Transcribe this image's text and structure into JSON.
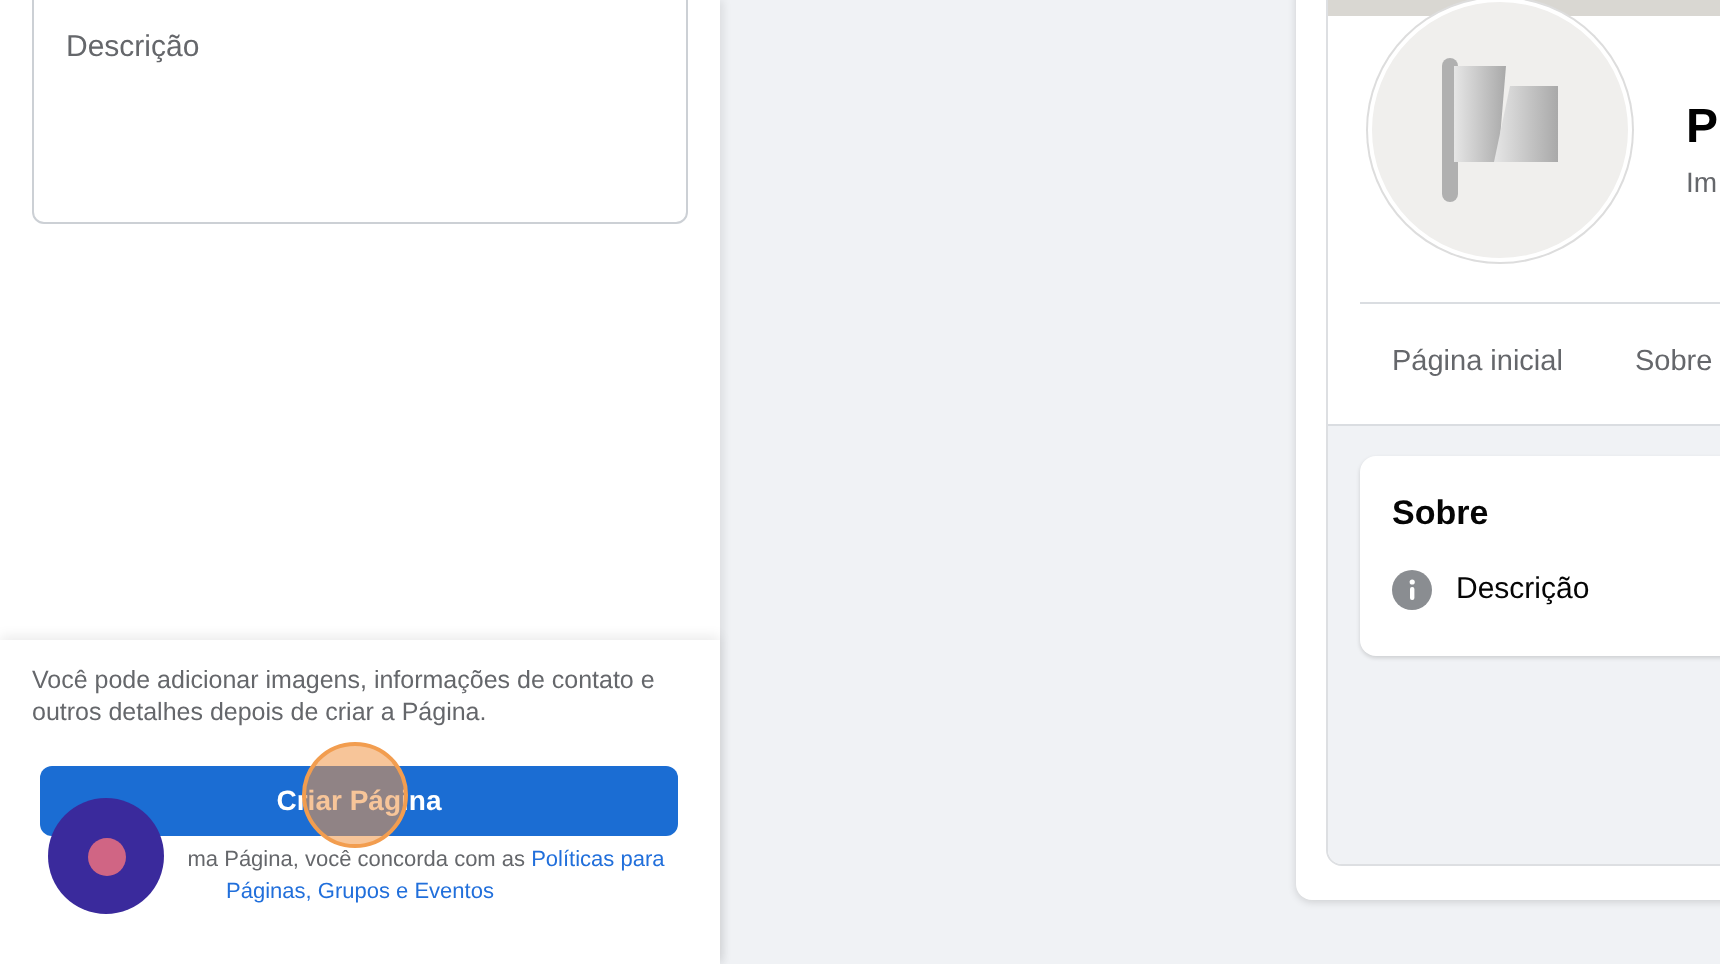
{
  "form": {
    "description_field": {
      "placeholder": "Descrição"
    }
  },
  "footer": {
    "note": "Você pode adicionar imagens, informações de contato e outros detalhes depois de criar a Página.",
    "button": "Criar Página",
    "terms": "ma Página, você concorda com as ",
    "terms_link": [
      "Políticas para",
      "Páginas, Grupos e Eventos"
    ]
  },
  "preview": {
    "title": "P",
    "subtitle": "Im",
    "tabs": [
      {
        "label": "Página inicial",
        "selected": false
      },
      {
        "label": "Sobre",
        "selected": false
      }
    ],
    "about": {
      "heading": "Sobre",
      "item": "Descrição"
    }
  }
}
